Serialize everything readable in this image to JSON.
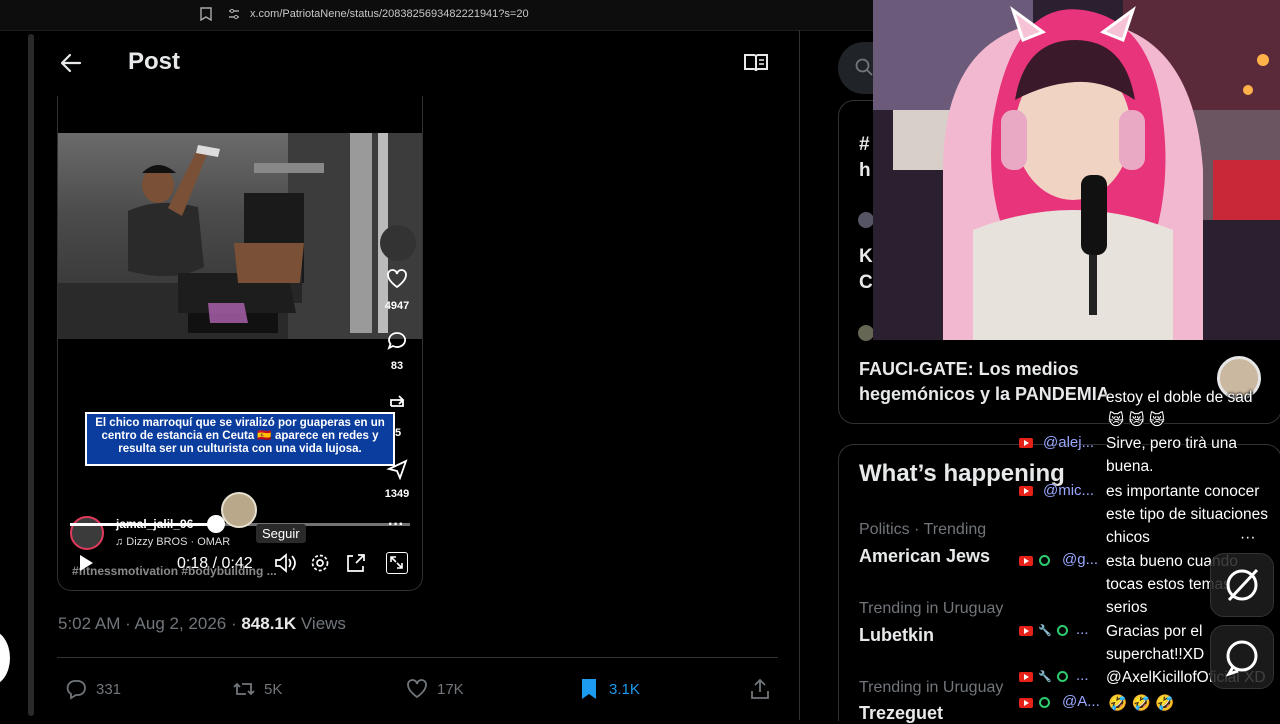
{
  "browser": {
    "url": "x.com/PatriotaNene/status/2083825693482221941?s=20"
  },
  "header": {
    "title": "Post"
  },
  "video": {
    "caption": "El chico marroquí que se viralizó por guaperas en un centro de estancia en Ceuta 🇪🇸 aparece en redes y resulta ser un culturista con una vida lujosa.",
    "likes": "4947",
    "comments": "83",
    "shares": "5",
    "saves": "1349",
    "username": "jamal_jalil_96",
    "music": "♫ Dizzy BROS · OMAR",
    "hashtags": "#fitnessmotivation #bodybuilding ...",
    "follow_tooltip": "Seguir",
    "time": "0:18 / 0:42",
    "progress": 0.43,
    "more": "···"
  },
  "post": {
    "timestamp": "5:02 AM · Aug 2, 2026 · ",
    "views_count": "848.1K",
    "views_label": " Views"
  },
  "actions": {
    "replies": "331",
    "reposts": "5K",
    "likes": "17K",
    "bookmarks": "3.1K"
  },
  "sidebar": {
    "hash_fragment": "#\nh",
    "k_fragment": "K\nC",
    "fauci_title": "FAUCI-GATE: Los medios hegemónicos y la PANDEMIA",
    "happening_title": "What’s happening",
    "trends": [
      {
        "meta": "Politics · Trending",
        "name": "American Jews"
      },
      {
        "meta": "Trending in Uruguay",
        "name": "Lubetkin"
      },
      {
        "meta": "Trending in Uruguay",
        "name": "Trezeguet"
      }
    ]
  },
  "chat": {
    "messages": [
      {
        "user": "",
        "text": "estoy el doble de sad"
      },
      {
        "user": "",
        "text": "😿 😿 😿"
      },
      {
        "user": "@alej...",
        "text": "Sirve, pero tirà una buena."
      },
      {
        "user": "@mic...",
        "text": "es importante conocer este tipo de situaciones chicos"
      },
      {
        "user": "@g...",
        "text": "esta bueno cuando tocas estos temas serios"
      },
      {
        "user": "...",
        "text": "Gracias por el superchat!!XD"
      },
      {
        "user": "...",
        "text": "@AxelKicillofOficial XD"
      },
      {
        "user": "@A...",
        "text": "🤣 🤣 🤣"
      }
    ],
    "more": "···"
  },
  "colors": {
    "accent": "#1d9bf0",
    "muted": "#71767b",
    "border": "#2f3336",
    "youtube": "#e62117"
  }
}
